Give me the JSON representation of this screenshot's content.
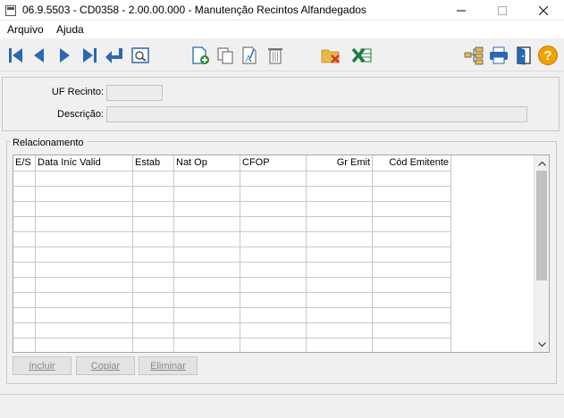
{
  "window": {
    "title": "06.9.5503 - CD0358 - 2.00.00.000 - Manutenção Recintos Alfandegados"
  },
  "menu": {
    "items": [
      {
        "label": "Arquivo"
      },
      {
        "label": "Ajuda"
      }
    ]
  },
  "toolbar": {
    "buttons": [
      {
        "icon": "first-record-icon"
      },
      {
        "icon": "previous-record-icon"
      },
      {
        "icon": "next-record-icon"
      },
      {
        "icon": "last-record-icon"
      },
      {
        "icon": "go-to-icon"
      },
      {
        "icon": "search-icon"
      },
      {
        "icon": "new-record-icon"
      },
      {
        "icon": "copy-record-icon"
      },
      {
        "icon": "edit-record-icon"
      },
      {
        "icon": "delete-record-icon"
      },
      {
        "icon": "folder-cancel-icon"
      },
      {
        "icon": "excel-icon"
      },
      {
        "icon": "tree-icon"
      },
      {
        "icon": "print-icon"
      },
      {
        "icon": "exit-door-icon"
      },
      {
        "icon": "help-icon"
      }
    ],
    "colors": {
      "blue": "#2b67b3",
      "green": "#2e8b34",
      "excel": "#1f7a3e",
      "help": "#f2a000",
      "folder": "#e8b84a",
      "cancel": "#d9342b"
    }
  },
  "form": {
    "uf_recinto": {
      "label": "UF Recinto:",
      "value": ""
    },
    "descricao": {
      "label": "Descrição:",
      "value": ""
    }
  },
  "relacionamento": {
    "title": "Relacionamento",
    "columns": [
      "E/S",
      "Data Iníc Valid",
      "Estab",
      "Nat Op",
      "CFOP",
      "Gr Emit",
      "Cód Emitente"
    ],
    "row_count": 12
  },
  "buttons": {
    "incluir": "Incluir",
    "copiar": "Copiar",
    "eliminar": "Eliminar"
  }
}
